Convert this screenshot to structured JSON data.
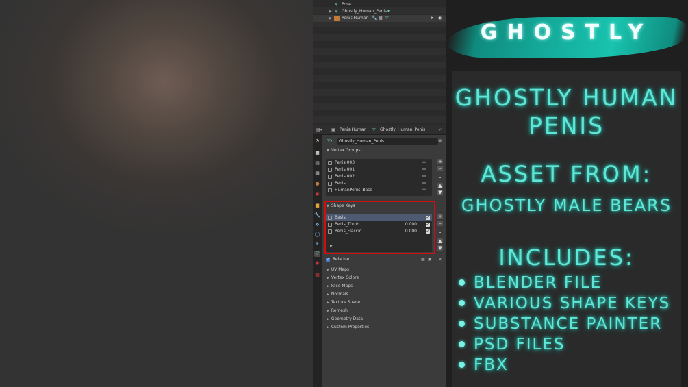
{
  "outliner": {
    "items": [
      {
        "label": "Pose",
        "icon": "pose-icon"
      },
      {
        "label": "Ghostly_Human_Penis",
        "icon": "armature-icon",
        "tail_icon": "bone-icon"
      },
      {
        "label": "Penis Human",
        "icon": "mesh-object-icon",
        "selected": true
      }
    ]
  },
  "properties": {
    "breadcrumb_object": "Penis Human",
    "breadcrumb_data": "Ghostly_Human_Penis",
    "mesh_name": "Ghostly_Human_Penis",
    "vertex_groups": {
      "title": "Vertex Groups",
      "items": [
        "Penis.003",
        "Penis.001",
        "Penis.002",
        "Penis",
        "HumanPenis_Base"
      ]
    },
    "shape_keys": {
      "title": "Shape Keys",
      "items": [
        {
          "name": "Basis",
          "value": "",
          "active": true
        },
        {
          "name": "Penis_Throb",
          "value": "0.000"
        },
        {
          "name": "Penis_Flaccid",
          "value": "0.000"
        }
      ],
      "relative_label": "Relative"
    },
    "collapsed_sections": [
      "UV Maps",
      "Vertex Colors",
      "Face Maps",
      "Normals",
      "Texture Space",
      "Remesh",
      "Geometry Data",
      "Custom Properties"
    ]
  },
  "promo": {
    "logo": "GHOSTLY",
    "title_line1": "GHOSTLY HUMAN",
    "title_line2": "PENIS",
    "asset_from": "ASSET FROM:",
    "source_product": "GHOSTLY MALE BEARS",
    "includes": "INCLUDES:",
    "bullets": [
      "BLENDER FILE",
      "VARIOUS SHAPE KEYS",
      "SUBSTANCE PAINTER",
      "PSD FILES",
      "FBX"
    ]
  },
  "colors": {
    "accent": "#5fe6d6",
    "highlight_box": "#d20f0f",
    "active_row": "#4d5a72"
  }
}
